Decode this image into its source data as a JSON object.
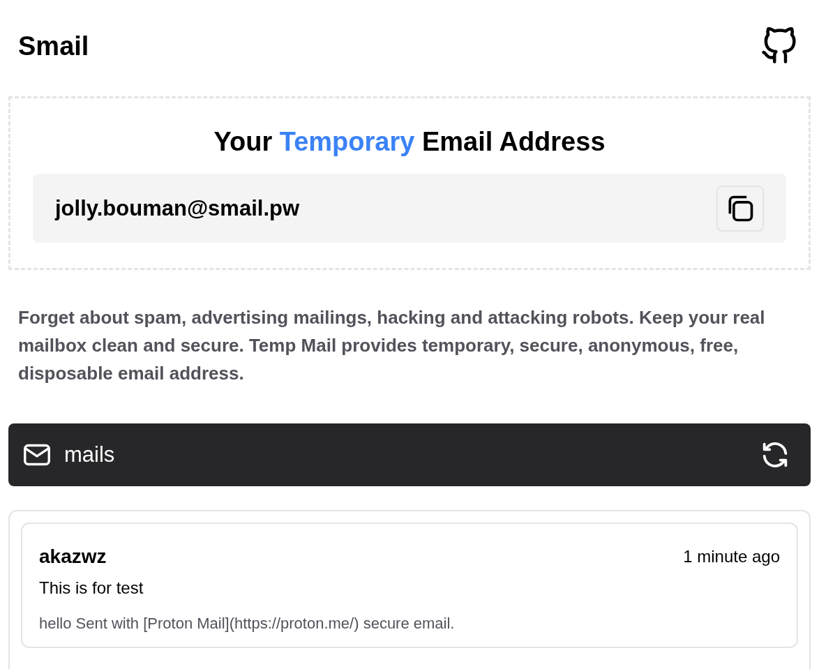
{
  "header": {
    "title": "Smail"
  },
  "address_card": {
    "heading": [
      {
        "text": "Your",
        "highlight": false
      },
      {
        "text": "Temporary",
        "highlight": true
      },
      {
        "text": "Email Address",
        "highlight": false
      }
    ],
    "email": "jolly.bouman@smail.pw"
  },
  "description": "Forget about spam, advertising mailings, hacking and attacking robots. Keep your real mailbox clean and secure. Temp Mail provides temporary, secure, anonymous, free, disposable email address.",
  "mails_bar": {
    "title": "mails"
  },
  "mails": [
    {
      "sender": "akazwz",
      "time": "1 minute ago",
      "subject": "This is for test",
      "preview": "hello Sent with [Proton Mail](https://proton.me/) secure email."
    }
  ]
}
